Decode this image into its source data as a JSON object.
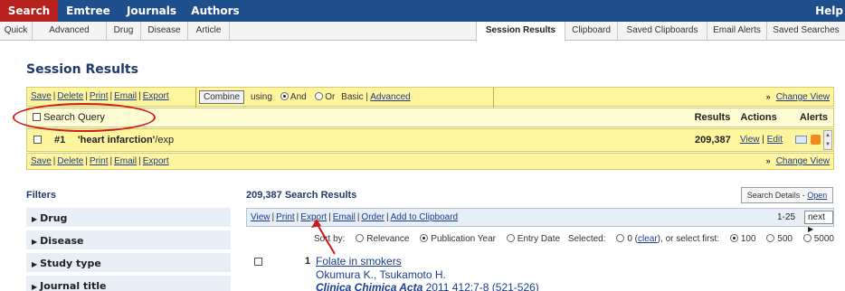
{
  "top_nav": {
    "items": [
      {
        "label": "Search",
        "active": true
      },
      {
        "label": "Emtree",
        "active": false
      },
      {
        "label": "Journals",
        "active": false
      },
      {
        "label": "Authors",
        "active": false
      }
    ],
    "help": "Help"
  },
  "sub_nav": {
    "items": [
      {
        "label": "Quick"
      },
      {
        "label": "Advanced"
      },
      {
        "label": "Drug"
      },
      {
        "label": "Disease"
      },
      {
        "label": "Article"
      },
      {
        "label": "Session Results",
        "active": true
      },
      {
        "label": "Clipboard"
      },
      {
        "label": "Saved Clipboards"
      },
      {
        "label": "Email Alerts"
      },
      {
        "label": "Saved Searches"
      }
    ]
  },
  "session": {
    "title": "Session Results",
    "actions": [
      "Save",
      "Delete",
      "Print",
      "Email",
      "Export"
    ],
    "combine_label": "Combine",
    "using_label": "using",
    "and_label": "And",
    "or_label": "Or",
    "basic_label": "Basic",
    "advanced_label": "Advanced",
    "change_view": "Change View",
    "header": {
      "search_query": "Search Query",
      "results": "Results",
      "actions": "Actions",
      "alerts": "Alerts"
    },
    "query": {
      "number": "#1",
      "text": "'heart infarction'",
      "suffix": "/exp",
      "count": "209,387",
      "view": "View",
      "edit": "Edit"
    }
  },
  "filters": {
    "title": "Filters",
    "items": [
      "Drug",
      "Disease",
      "Study type",
      "Journal title"
    ]
  },
  "results": {
    "title": "209,387 Search Results",
    "search_details": "Search Details",
    "open": "Open",
    "toolbar": [
      "View",
      "Print",
      "Export",
      "Email",
      "Order",
      "Add to Clipboard"
    ],
    "range": "1-25",
    "next": "next",
    "sort_by": "Sort by:",
    "sort_options": [
      {
        "label": "Relevance",
        "selected": false
      },
      {
        "label": "Publication Year",
        "selected": true
      },
      {
        "label": "Entry Date",
        "selected": false
      }
    ],
    "selected_label": "Selected:",
    "selected_count": "0",
    "clear": "clear",
    "select_first": ", or select first:",
    "first_options": [
      {
        "label": "100",
        "selected": true
      },
      {
        "label": "500",
        "selected": false
      },
      {
        "label": "5000",
        "selected": false
      }
    ],
    "item": {
      "number": "1",
      "title": "Folate in smokers",
      "authors": "Okumura K., Tsukamoto H.",
      "journal": "Clinica Chimica Acta",
      "details": " 2011 412:7-8 (521-526)"
    }
  },
  "colors": {
    "nav_blue": "#1f4e8c",
    "active_red": "#b8201e",
    "highlight_yellow": "#fff59f",
    "annotation_red": "#d11a1a",
    "link_blue": "#1a3c8e"
  }
}
